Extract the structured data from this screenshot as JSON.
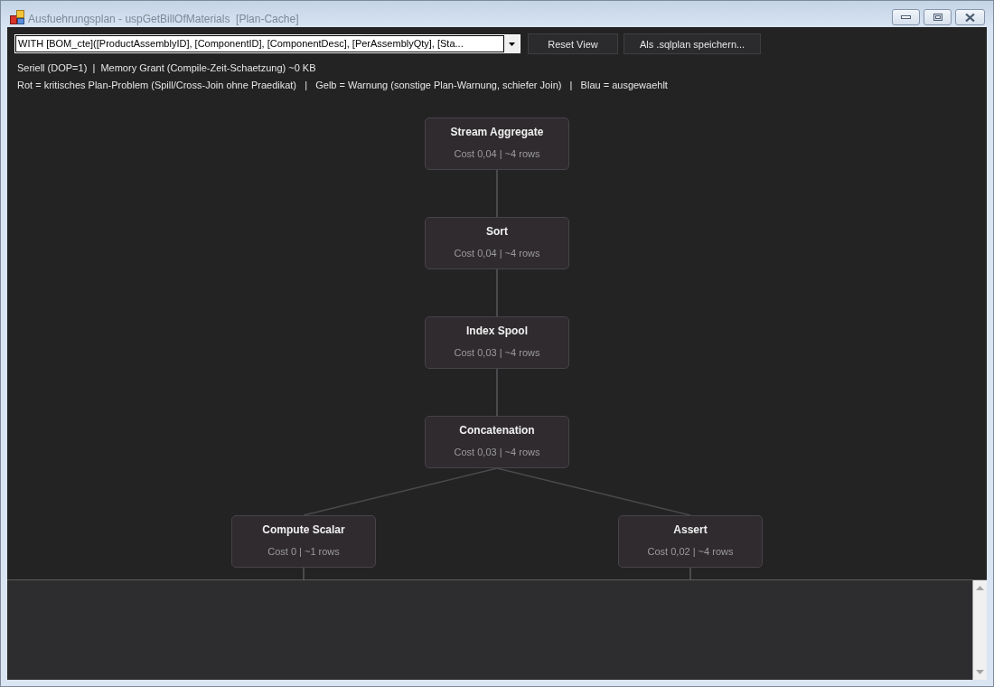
{
  "window": {
    "title": "Ausfuehrungsplan - uspGetBillOfMaterials  [Plan-Cache]"
  },
  "toolbar": {
    "query_select": {
      "value": "WITH [BOM_cte]([ProductAssemblyID], [ComponentID], [ComponentDesc], [PerAssemblyQty], [Sta..."
    },
    "buttons": [
      "Reset View",
      "Als .sqlplan speichern..."
    ]
  },
  "info_lines": [
    "Seriell (DOP=1)  |  Memory Grant (Compile-Zeit-Schaetzung) ~0 KB",
    "Rot = kritisches Plan-Problem (Spill/Cross-Join ohne Praedikat)   |   Gelb = Warnung (sonstige Plan-Warnung, schiefer Join)   |   Blau = ausgewaehlt"
  ],
  "plan": {
    "nodes": [
      {
        "name": "Stream Aggregate",
        "stats": "Cost 0,04 | ~4 rows",
        "continues_below": false,
        "children": [
          {
            "name": "Sort",
            "stats": "Cost 0,04 | ~4 rows",
            "continues_below": false,
            "children": [
              {
                "name": "Index Spool",
                "stats": "Cost 0,03 | ~4 rows",
                "continues_below": false,
                "children": [
                  {
                    "name": "Concatenation",
                    "stats": "Cost 0,03 | ~4 rows",
                    "continues_below": false,
                    "children": [
                      {
                        "name": "Compute Scalar",
                        "stats": "Cost 0 | ~1 rows",
                        "continues_below": true
                      },
                      {
                        "name": "Assert",
                        "stats": "Cost 0,02 | ~4 rows",
                        "continues_below": true
                      }
                    ]
                  }
                ]
              }
            ]
          }
        ]
      }
    ]
  }
}
